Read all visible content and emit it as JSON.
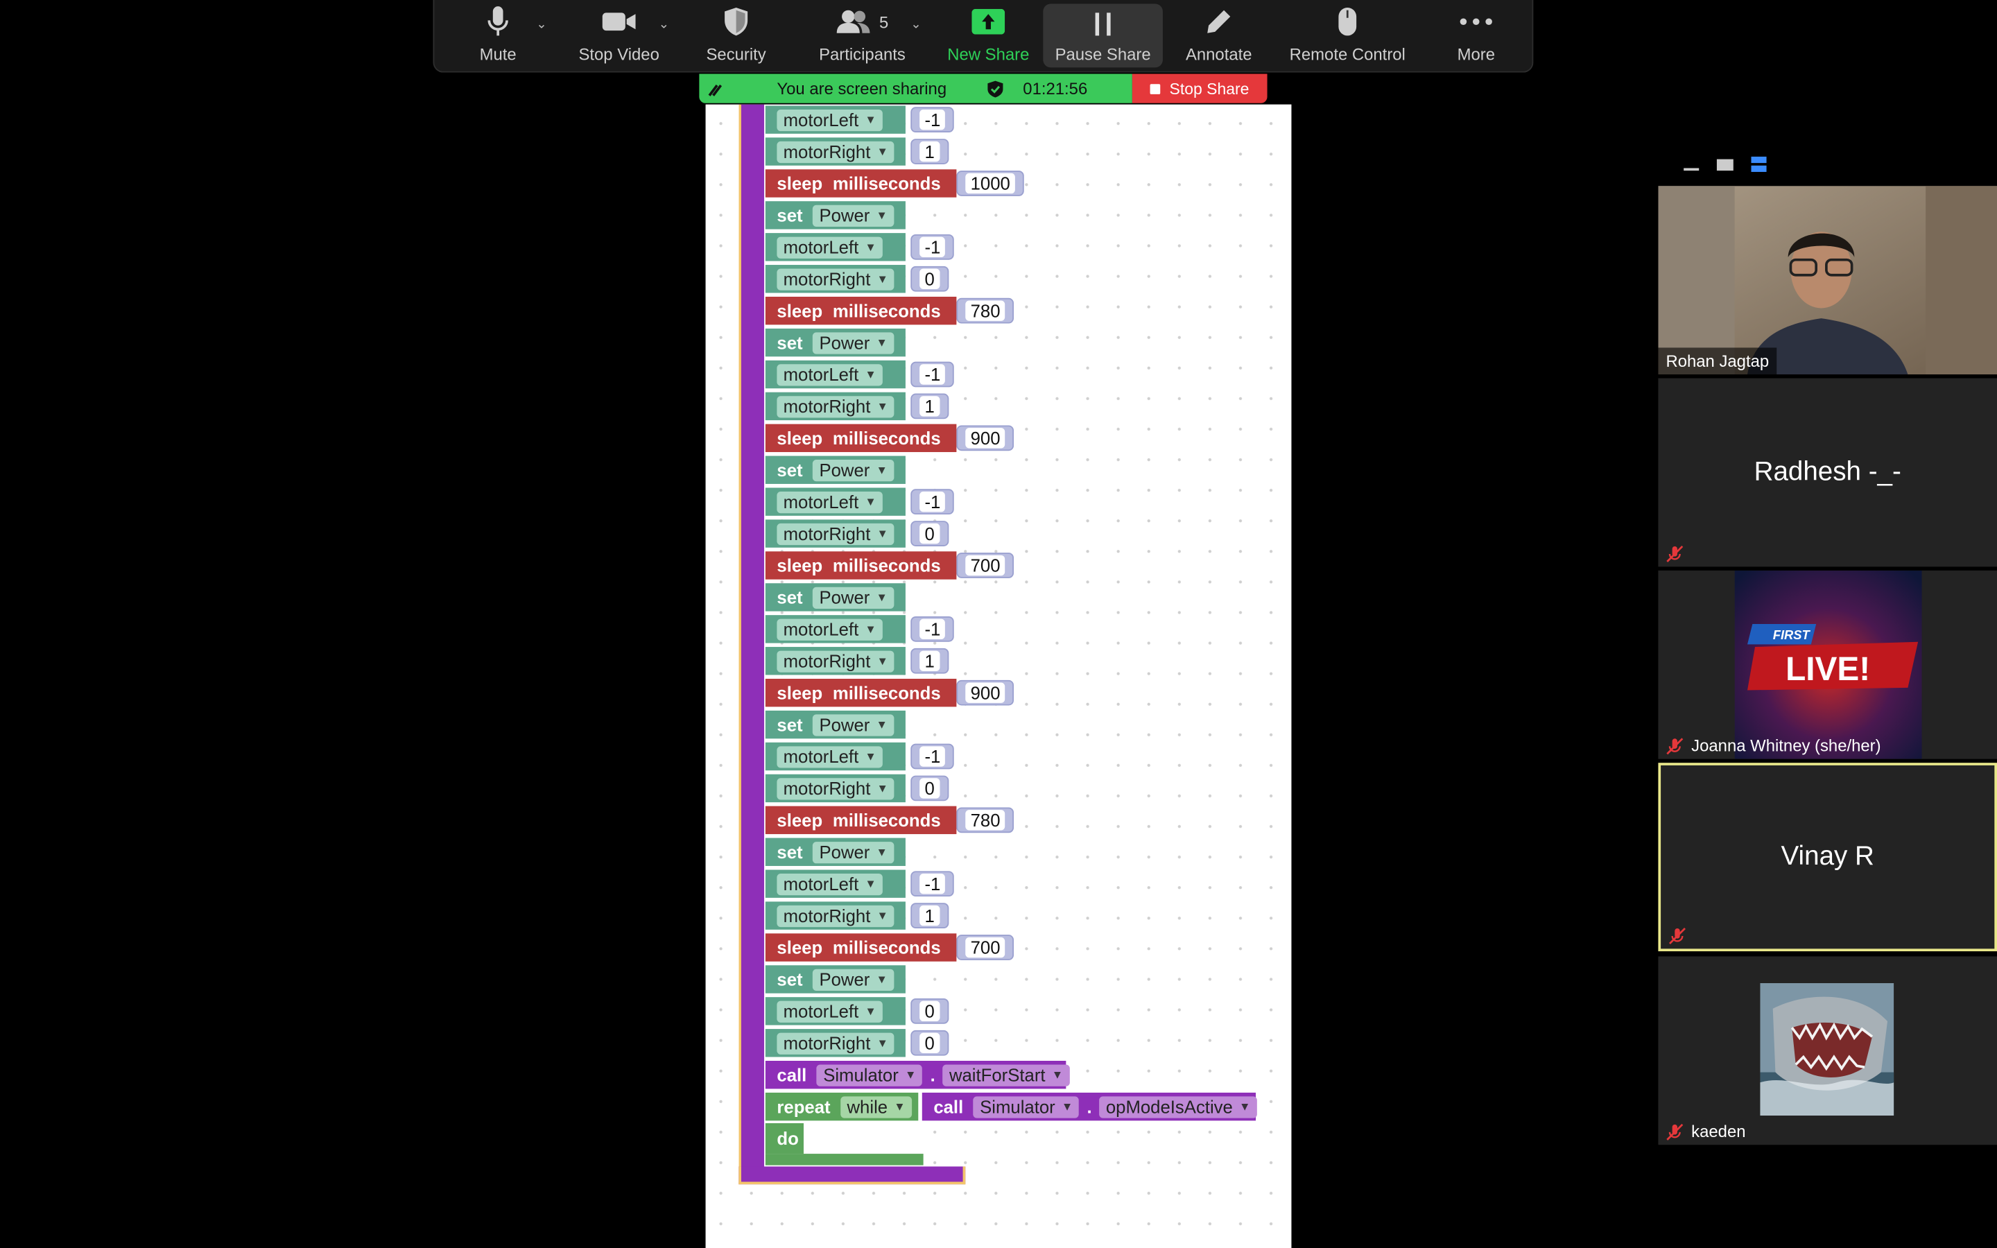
{
  "toolbar": {
    "mute": "Mute",
    "stop_video": "Stop Video",
    "security": "Security",
    "participants": "Participants",
    "participants_count": "5",
    "new_share": "New Share",
    "pause_share": "Pause Share",
    "annotate": "Annotate",
    "remote_control": "Remote Control",
    "more": "More"
  },
  "sharing": {
    "message": "You are screen sharing",
    "elapsed": "01:21:56",
    "stop_label": "Stop Share",
    "banner_color": "#3bc95a",
    "stop_color": "#e5383b"
  },
  "blocks": {
    "set": "set",
    "power": "Power",
    "motor_left": "motorLeft",
    "motor_right": "motorRight",
    "sleep": "sleep",
    "milliseconds": "milliseconds",
    "call": "call",
    "simulator": "Simulator",
    "dot": ".",
    "wait_for_start": "waitForStart",
    "repeat": "repeat",
    "while": "while",
    "op_mode_is_active": "opModeIsActive",
    "do": "do",
    "first_left": "-1",
    "first_right": "1",
    "steps": [
      {
        "sleep": "1000",
        "left": "-1",
        "right": "0"
      },
      {
        "sleep": "780",
        "left": "-1",
        "right": "1"
      },
      {
        "sleep": "900",
        "left": "-1",
        "right": "0"
      },
      {
        "sleep": "700",
        "left": "-1",
        "right": "1"
      },
      {
        "sleep": "900",
        "left": "-1",
        "right": "0"
      },
      {
        "sleep": "780",
        "left": "-1",
        "right": "1"
      },
      {
        "sleep": "700",
        "left": "0",
        "right": "0"
      }
    ]
  },
  "participants": [
    {
      "name": "Rohan Jagtap",
      "type": "video",
      "muted": false
    },
    {
      "name": "Radhesh -_-",
      "type": "name",
      "muted": true
    },
    {
      "name": "Joanna Whitney (she/her)",
      "type": "image",
      "muted": true,
      "image_text_top": "FIRST",
      "image_text_main": "LIVE!"
    },
    {
      "name": "Vinay R",
      "type": "name",
      "muted": true,
      "active": true
    },
    {
      "name": "kaeden",
      "type": "image",
      "muted": true
    }
  ]
}
